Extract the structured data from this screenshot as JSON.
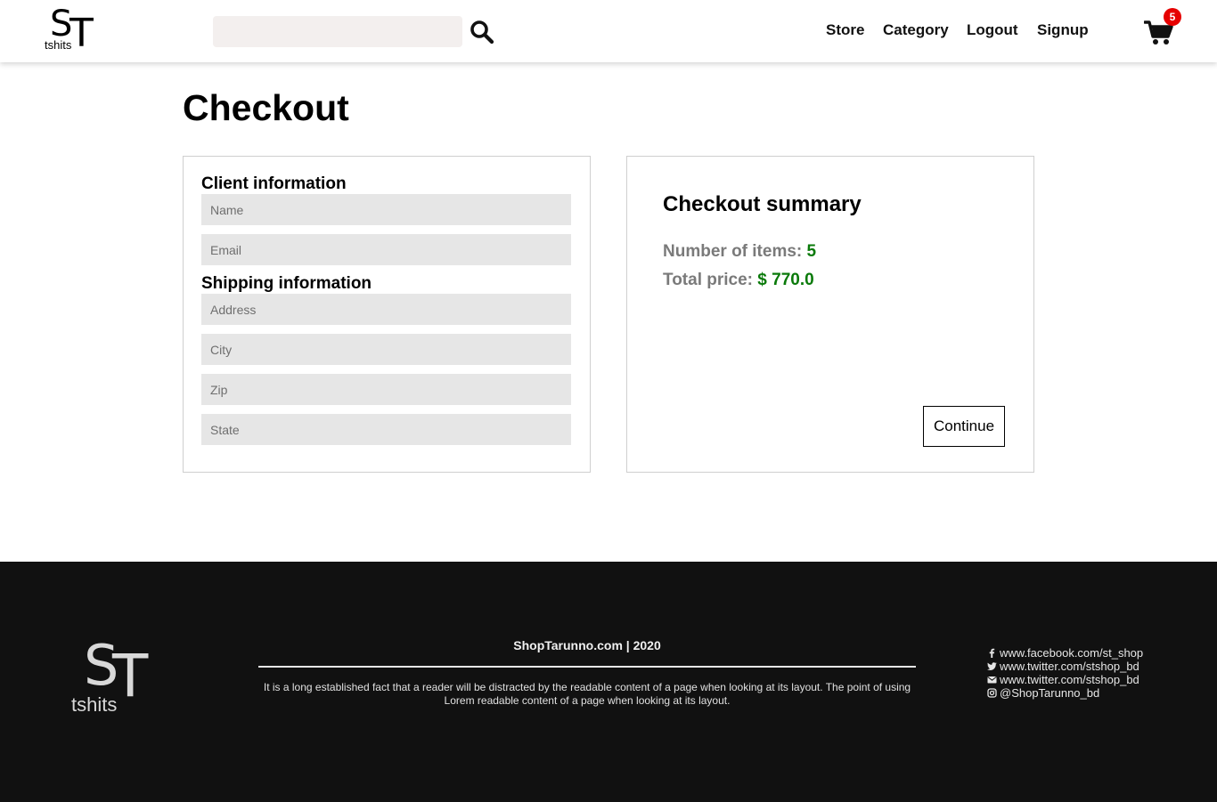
{
  "header": {
    "logo_big_s": "S",
    "logo_big_t": "T",
    "logo_text": "tshits",
    "search_placeholder": "",
    "nav": {
      "store": "Store",
      "category": "Category",
      "logout": "Logout",
      "signup": "Signup"
    },
    "cart_count": "5",
    "icons": {
      "search": "search-icon",
      "cart": "cart-icon"
    }
  },
  "main": {
    "title": "Checkout",
    "client_form": {
      "client_heading": "Client information",
      "shipping_heading": "Shipping information",
      "fields": {
        "name": {
          "placeholder": "Name",
          "value": ""
        },
        "email": {
          "placeholder": "Email",
          "value": ""
        },
        "address": {
          "placeholder": "Address",
          "value": ""
        },
        "city": {
          "placeholder": "City",
          "value": ""
        },
        "zip": {
          "placeholder": "Zip",
          "value": ""
        },
        "state": {
          "placeholder": "State",
          "value": ""
        }
      }
    },
    "summary": {
      "title": "Checkout summary",
      "items_label": "Number of items:",
      "items_value": "5",
      "total_label": "Total price:",
      "currency": "$",
      "total_value": "770.0",
      "continue_label": "Continue"
    }
  },
  "footer": {
    "logo_big_s": "S",
    "logo_big_t": "T",
    "logo_text": "tshits",
    "brand": "ShopTarunno.com | 2020",
    "description": "It is a long established fact that a reader will be distracted by the readable content of a page when looking at its layout. The point of using Lorem readable content of a page when looking at its layout.",
    "social": [
      {
        "icon": "facebook-icon",
        "text": "www.facebook.com/st_shop"
      },
      {
        "icon": "twitter-icon",
        "text": "www.twitter.com/stshop_bd"
      },
      {
        "icon": "envelope-icon",
        "text": "www.twitter.com/stshop_bd"
      },
      {
        "icon": "instagram-icon",
        "text": "@ShopTarunno_bd"
      }
    ]
  },
  "colors": {
    "accent_green": "#0a7a0a",
    "badge_red": "#e60000",
    "footer_bg": "#111111",
    "field_bg": "#e6e6e6",
    "search_bg": "#f3efee"
  }
}
